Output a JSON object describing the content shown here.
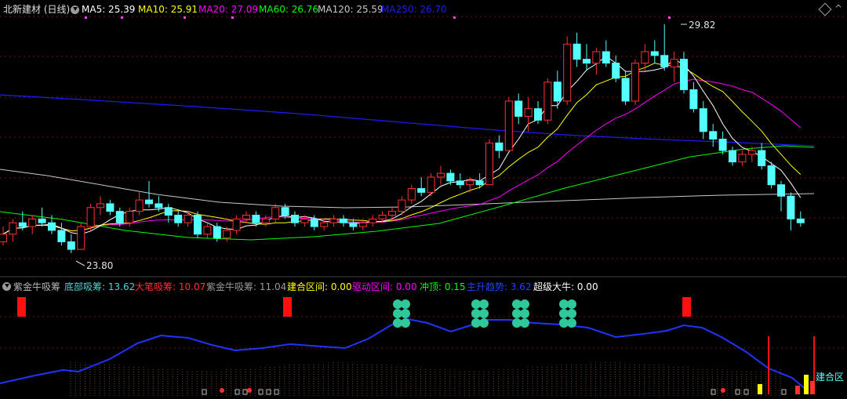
{
  "stock": {
    "name": "北新建材",
    "period": "(日线)"
  },
  "ma_legend": [
    {
      "label": "MA5: 25.39",
      "color": "#ffffff"
    },
    {
      "label": "MA10: 25.91",
      "color": "#ffff00"
    },
    {
      "label": "MA20: 27.09",
      "color": "#ff00ff"
    },
    {
      "label": "MA60: 26.76",
      "color": "#00ff00"
    },
    {
      "label": "MA120: 25.59",
      "color": "#c8c8c8"
    },
    {
      "label": "MA250: 26.70",
      "color": "#1c1cff"
    }
  ],
  "price_annotations": {
    "high": "29.82",
    "low": "23.80"
  },
  "indicator": {
    "name": "紫金牛吸筹",
    "items": [
      {
        "label": "底部吸筹: 13.62",
        "color": "#4fd4d4"
      },
      {
        "label": "大笔吸筹: 10.07",
        "color": "#ff3030"
      },
      {
        "label": "紫金牛吸筹: 11.04",
        "color": "#9a9a9a"
      },
      {
        "label": "建合区间: 0.00",
        "color": "#ffff00"
      },
      {
        "label": "驱动区间: 0.00",
        "color": "#ff00ff"
      },
      {
        "label": "冲顶: 0.15",
        "color": "#00ff00"
      },
      {
        "label": "主升趋势: 3.62",
        "color": "#2040ff"
      },
      {
        "label": "超级大牛: 0.00",
        "color": "#ffffff"
      }
    ],
    "zone_label": "建合区"
  },
  "colors": {
    "up": "#ff3030",
    "down": "#54ffff",
    "grid": "#7a1010",
    "ma5": "#ffffff",
    "ma10": "#ffff00",
    "ma20": "#ff00ff",
    "ma60": "#00ff00",
    "ma120": "#c8c8c8",
    "ma250": "#1c1cff",
    "trend": "#2233ff",
    "signal": "#ff1010",
    "badge": "#2ec89a"
  },
  "chart_data": {
    "type": "candlestick",
    "candles": [
      [
        24.1,
        24.5,
        24.0,
        24.3
      ],
      [
        24.3,
        24.7,
        24.1,
        24.6
      ],
      [
        24.6,
        24.9,
        24.4,
        24.5
      ],
      [
        24.5,
        24.8,
        24.3,
        24.7
      ],
      [
        24.7,
        25.0,
        24.5,
        24.6
      ],
      [
        24.6,
        24.8,
        24.3,
        24.4
      ],
      [
        24.4,
        24.6,
        24.0,
        24.1
      ],
      [
        24.1,
        24.3,
        23.8,
        23.9
      ],
      [
        23.9,
        24.6,
        23.9,
        24.5
      ],
      [
        24.5,
        25.1,
        24.4,
        25.0
      ],
      [
        25.0,
        25.3,
        24.8,
        25.1
      ],
      [
        25.1,
        25.2,
        24.8,
        24.9
      ],
      [
        24.9,
        25.0,
        24.5,
        24.6
      ],
      [
        24.6,
        25.0,
        24.5,
        24.9
      ],
      [
        24.9,
        25.4,
        24.8,
        25.2
      ],
      [
        25.2,
        25.7,
        25.0,
        25.1
      ],
      [
        25.1,
        25.3,
        24.9,
        25.0
      ],
      [
        25.0,
        25.1,
        24.6,
        24.8
      ],
      [
        24.8,
        24.9,
        24.5,
        24.6
      ],
      [
        24.6,
        24.9,
        24.5,
        24.8
      ],
      [
        24.8,
        24.9,
        24.2,
        24.3
      ],
      [
        24.3,
        24.6,
        24.2,
        24.5
      ],
      [
        24.5,
        24.6,
        24.1,
        24.2
      ],
      [
        24.2,
        24.5,
        24.1,
        24.4
      ],
      [
        24.4,
        24.8,
        24.3,
        24.7
      ],
      [
        24.7,
        24.9,
        24.6,
        24.8
      ],
      [
        24.8,
        24.9,
        24.5,
        24.6
      ],
      [
        24.6,
        24.8,
        24.5,
        24.7
      ],
      [
        24.7,
        25.1,
        24.6,
        25.0
      ],
      [
        25.0,
        25.1,
        24.7,
        24.8
      ],
      [
        24.8,
        24.9,
        24.5,
        24.6
      ],
      [
        24.6,
        24.8,
        24.5,
        24.7
      ],
      [
        24.7,
        24.8,
        24.4,
        24.5
      ],
      [
        24.5,
        24.7,
        24.4,
        24.6
      ],
      [
        24.6,
        24.8,
        24.5,
        24.7
      ],
      [
        24.7,
        24.8,
        24.5,
        24.6
      ],
      [
        24.6,
        24.7,
        24.4,
        24.5
      ],
      [
        24.5,
        24.7,
        24.4,
        24.6
      ],
      [
        24.6,
        24.8,
        24.5,
        24.7
      ],
      [
        24.7,
        24.9,
        24.6,
        24.8
      ],
      [
        24.8,
        25.0,
        24.7,
        24.9
      ],
      [
        24.9,
        25.3,
        24.8,
        25.2
      ],
      [
        25.2,
        25.6,
        25.1,
        25.5
      ],
      [
        25.5,
        25.8,
        25.3,
        25.4
      ],
      [
        25.4,
        25.9,
        25.3,
        25.8
      ],
      [
        25.8,
        26.1,
        25.6,
        25.9
      ],
      [
        25.9,
        26.0,
        25.6,
        25.7
      ],
      [
        25.7,
        25.9,
        25.5,
        25.6
      ],
      [
        25.6,
        25.8,
        25.4,
        25.7
      ],
      [
        25.7,
        25.9,
        25.5,
        25.6
      ],
      [
        25.6,
        26.8,
        25.6,
        26.7
      ],
      [
        26.7,
        26.9,
        26.3,
        26.5
      ],
      [
        26.5,
        27.9,
        26.5,
        27.8
      ],
      [
        27.8,
        28.0,
        27.2,
        27.4
      ],
      [
        27.4,
        27.9,
        27.0,
        27.6
      ],
      [
        27.6,
        27.8,
        27.2,
        27.3
      ],
      [
        27.3,
        28.4,
        27.2,
        28.3
      ],
      [
        28.3,
        28.6,
        27.6,
        27.8
      ],
      [
        27.8,
        29.5,
        27.7,
        29.3
      ],
      [
        29.3,
        29.6,
        28.7,
        28.9
      ],
      [
        28.9,
        29.3,
        28.6,
        28.8
      ],
      [
        28.8,
        29.2,
        28.5,
        29.1
      ],
      [
        29.1,
        29.4,
        28.7,
        28.8
      ],
      [
        28.8,
        29.0,
        28.3,
        28.4
      ],
      [
        28.4,
        28.6,
        27.7,
        27.8
      ],
      [
        27.8,
        28.9,
        27.7,
        28.8
      ],
      [
        28.8,
        29.3,
        28.6,
        29.1
      ],
      [
        29.1,
        29.4,
        28.8,
        29.0
      ],
      [
        29.0,
        29.82,
        28.6,
        28.7
      ],
      [
        28.7,
        29.1,
        28.3,
        28.9
      ],
      [
        28.9,
        29.1,
        28.0,
        28.1
      ],
      [
        28.1,
        28.3,
        27.5,
        27.6
      ],
      [
        27.6,
        27.8,
        26.8,
        27.0
      ],
      [
        27.0,
        27.2,
        26.6,
        26.8
      ],
      [
        26.8,
        27.0,
        26.4,
        26.5
      ],
      [
        26.5,
        26.6,
        26.1,
        26.2
      ],
      [
        26.2,
        26.5,
        26.1,
        26.4
      ],
      [
        26.4,
        26.6,
        26.2,
        26.5
      ],
      [
        26.5,
        26.7,
        26.0,
        26.1
      ],
      [
        26.1,
        26.2,
        25.5,
        25.6
      ],
      [
        25.6,
        25.7,
        24.9,
        25.3
      ],
      [
        25.3,
        25.4,
        24.4,
        24.7
      ],
      [
        24.7,
        24.9,
        24.5,
        24.6
      ]
    ]
  }
}
